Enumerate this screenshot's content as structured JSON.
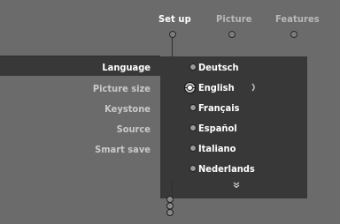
{
  "tabs": [
    {
      "label": "Set up",
      "state": "active"
    },
    {
      "label": "Picture",
      "state": "inactive"
    },
    {
      "label": "Features",
      "state": "inactive"
    }
  ],
  "setup_menu": {
    "items": [
      {
        "label": "Language",
        "state": "active"
      },
      {
        "label": "Picture size",
        "state": "dim"
      },
      {
        "label": "Keystone",
        "state": "dim"
      },
      {
        "label": "Source",
        "state": "dim"
      },
      {
        "label": "Smart save",
        "state": "dim"
      }
    ]
  },
  "language_options": {
    "selected": "English",
    "items": [
      "Deutsch",
      "English",
      "Français",
      "Español",
      "Italiano",
      "Nederlands"
    ],
    "more_indicator": "»"
  },
  "colors": {
    "background": "#6b6b6b",
    "panel": "#383838",
    "active_text": "#ffffff",
    "dim_text": "#c9c9c9"
  },
  "icons": {
    "selected_option": "radio-selected-icon",
    "scroll_more": "chevron-double-down-icon",
    "submenu_indicator": "parenthesis-icon"
  }
}
